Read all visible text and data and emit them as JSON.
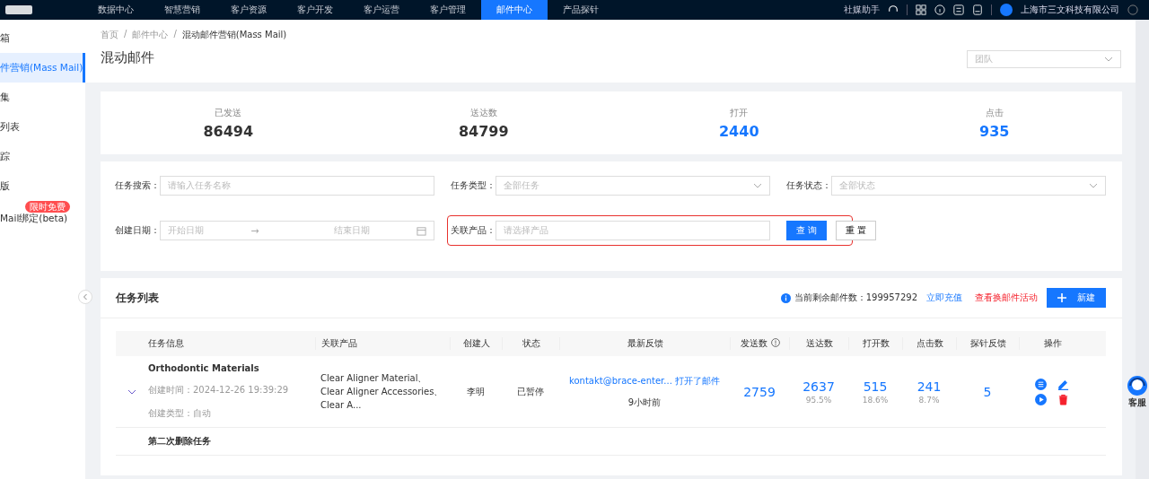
{
  "topnav": {
    "items": [
      {
        "label": "数据中心",
        "selected": false
      },
      {
        "label": "智慧营销",
        "selected": false
      },
      {
        "label": "客户资源",
        "selected": false
      },
      {
        "label": "客户开发",
        "selected": false
      },
      {
        "label": "客户运营",
        "selected": false
      },
      {
        "label": "客户管理",
        "selected": false
      },
      {
        "label": "邮件中心",
        "selected": true
      },
      {
        "label": "产品探针",
        "selected": false
      }
    ],
    "assistant": "社媒助手",
    "company": "上海市三文科技有限公司"
  },
  "sidebar": {
    "items": [
      {
        "label": "箱",
        "selected": false
      },
      {
        "label": "件营销(Mass Mail)",
        "selected": true
      },
      {
        "label": "集",
        "selected": false
      },
      {
        "label": "列表",
        "selected": false
      },
      {
        "label": "踪",
        "selected": false
      },
      {
        "label": "版",
        "selected": false
      },
      {
        "label": "Mail绑定(beta)",
        "selected": false,
        "badge": "限时免费"
      }
    ]
  },
  "breadcrumb": [
    "首页",
    "邮件中心",
    "混动邮件营销(Mass Mail)"
  ],
  "breadcrumb_separator": "/",
  "page_title": "混动邮件",
  "team_select": {
    "placeholder": "团队"
  },
  "stats": [
    {
      "label": "已发送",
      "value": "86494",
      "kind": "plain"
    },
    {
      "label": "送达数",
      "value": "84799",
      "kind": "plain"
    },
    {
      "label": "打开",
      "value": "2440",
      "kind": "link"
    },
    {
      "label": "点击",
      "value": "935",
      "kind": "link"
    }
  ],
  "filters": [
    {
      "label": "任务搜索：",
      "kind": "input",
      "placeholder": "请输入任务名称",
      "highlighted": false
    },
    {
      "label": "任务类型：",
      "kind": "select",
      "placeholder": "全部任务",
      "highlighted": false
    },
    {
      "label": "任务状态：",
      "kind": "select",
      "placeholder": "全部状态",
      "highlighted": false
    },
    {
      "label": "创建日期：",
      "kind": "daterange",
      "placeholder": "开始日期",
      "placeholder_end": "结束日期",
      "range_arrow": "→",
      "highlighted": false
    },
    {
      "label": "关联产品：",
      "kind": "input",
      "placeholder": "请选择产品",
      "highlighted": true
    }
  ],
  "filter_buttons": {
    "query": "查 询",
    "reset": "重 置"
  },
  "task_list": {
    "title": "任务列表",
    "remaining_label": "当前剩余邮件数：",
    "remaining": "199957292",
    "recharge": "立即充值",
    "activity": "查看换邮件活动",
    "new_button": "新建",
    "columns": [
      "任务信息",
      "关联产品",
      "创建人",
      "状态",
      "最新反馈",
      "发送数",
      "送达数",
      "打开数",
      "点击数",
      "探针反馈",
      "操作"
    ],
    "rows": [
      {
        "name": "Orthodontic Materials",
        "expanded": false,
        "created_label": "创建时间：",
        "created": "2024-12-26 19:39:29",
        "type_label": "创建类型：",
        "type": "自动",
        "products": "Clear Aligner Material、Clear Aligner Accessories、Clear A...",
        "creator": "李明",
        "status": "已暂停",
        "feedback": "kontakt@brace-enter... 打开了邮件",
        "feedback_time": "9小时前",
        "sent": "2759",
        "delivered": "2637",
        "delivered_rate": "95.5%",
        "opened": "515",
        "opened_rate": "18.6%",
        "clicked": "241",
        "clicked_rate": "8.7%",
        "probe": "5"
      },
      {
        "name": "第二次删除任务"
      }
    ]
  },
  "service": {
    "label": "客服"
  }
}
